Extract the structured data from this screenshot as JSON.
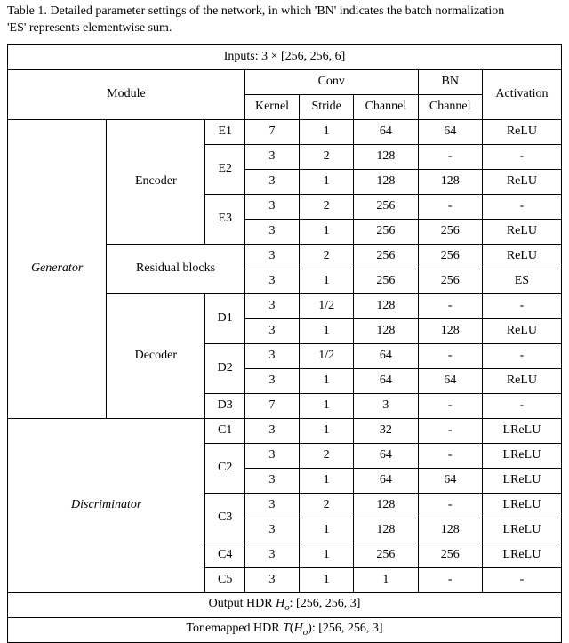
{
  "caption_prefix": "Table 1. Detailed parameter settings of the network, in which 'BN' indicates the batch normalization",
  "caption_suffix": "'ES' represents elementwise sum.",
  "inputs_label": "Inputs: 3 × [256, 256, 6]",
  "headers": {
    "module": "Module",
    "conv": "Conv",
    "bn": "BN",
    "activation": "Activation",
    "kernel": "Kernel",
    "stride": "Stride",
    "channel_conv": "Channel",
    "channel_bn": "Channel"
  },
  "row_groups": {
    "generator": "Generator",
    "discriminator": "Discriminator",
    "encoder": "Encoder",
    "residual": "Residual blocks",
    "decoder": "Decoder"
  },
  "layer_labels": {
    "E1": "E1",
    "E2": "E2",
    "E3": "E3",
    "D1": "D1",
    "D2": "D2",
    "D3": "D3",
    "C1": "C1",
    "C2": "C2",
    "C3": "C3",
    "C4": "C4",
    "C5": "C5"
  },
  "chart_data": {
    "type": "table",
    "title": "Detailed parameter settings of the network",
    "columns": [
      "group",
      "module",
      "layer",
      "kernel",
      "stride",
      "conv_channel",
      "bn_channel",
      "activation"
    ],
    "rows": [
      [
        "Generator",
        "Encoder",
        "E1",
        7,
        1,
        64,
        64,
        "ReLU"
      ],
      [
        "Generator",
        "Encoder",
        "E2",
        3,
        2,
        128,
        "-",
        "-"
      ],
      [
        "Generator",
        "Encoder",
        "E2",
        3,
        1,
        128,
        128,
        "ReLU"
      ],
      [
        "Generator",
        "Encoder",
        "E3",
        3,
        2,
        256,
        "-",
        "-"
      ],
      [
        "Generator",
        "Encoder",
        "E3",
        3,
        1,
        256,
        256,
        "ReLU"
      ],
      [
        "Generator",
        "Residual blocks",
        "",
        3,
        2,
        256,
        256,
        "ReLU"
      ],
      [
        "Generator",
        "Residual blocks",
        "",
        3,
        1,
        256,
        256,
        "ES"
      ],
      [
        "Generator",
        "Decoder",
        "D1",
        3,
        "1/2",
        128,
        "-",
        "-"
      ],
      [
        "Generator",
        "Decoder",
        "D1",
        3,
        1,
        128,
        128,
        "ReLU"
      ],
      [
        "Generator",
        "Decoder",
        "D2",
        3,
        "1/2",
        64,
        "-",
        "-"
      ],
      [
        "Generator",
        "Decoder",
        "D2",
        3,
        1,
        64,
        64,
        "ReLU"
      ],
      [
        "Generator",
        "Decoder",
        "D3",
        7,
        1,
        3,
        "-",
        "-"
      ],
      [
        "Discriminator",
        "",
        "C1",
        3,
        1,
        32,
        "-",
        "LReLU"
      ],
      [
        "Discriminator",
        "",
        "C2",
        3,
        2,
        64,
        "-",
        "LReLU"
      ],
      [
        "Discriminator",
        "",
        "C2",
        3,
        1,
        64,
        64,
        "LReLU"
      ],
      [
        "Discriminator",
        "",
        "C3",
        3,
        2,
        128,
        "-",
        "LReLU"
      ],
      [
        "Discriminator",
        "",
        "C3",
        3,
        1,
        128,
        128,
        "LReLU"
      ],
      [
        "Discriminator",
        "",
        "C4",
        3,
        1,
        256,
        256,
        "LReLU"
      ],
      [
        "Discriminator",
        "",
        "C5",
        3,
        1,
        1,
        "-",
        "-"
      ]
    ]
  },
  "output_hdr_prefix": "Output HDR ",
  "output_hdr_var": "H",
  "output_hdr_sub": "o",
  "output_hdr_suffix": ": [256, 256, 3]",
  "tonemapped_prefix": "Tonemapped HDR ",
  "tonemapped_T": "T",
  "tonemapped_open": "(",
  "tonemapped_var": "H",
  "tonemapped_sub": "o",
  "tonemapped_close": ")",
  "tonemapped_suffix": ": [256, 256, 3]"
}
